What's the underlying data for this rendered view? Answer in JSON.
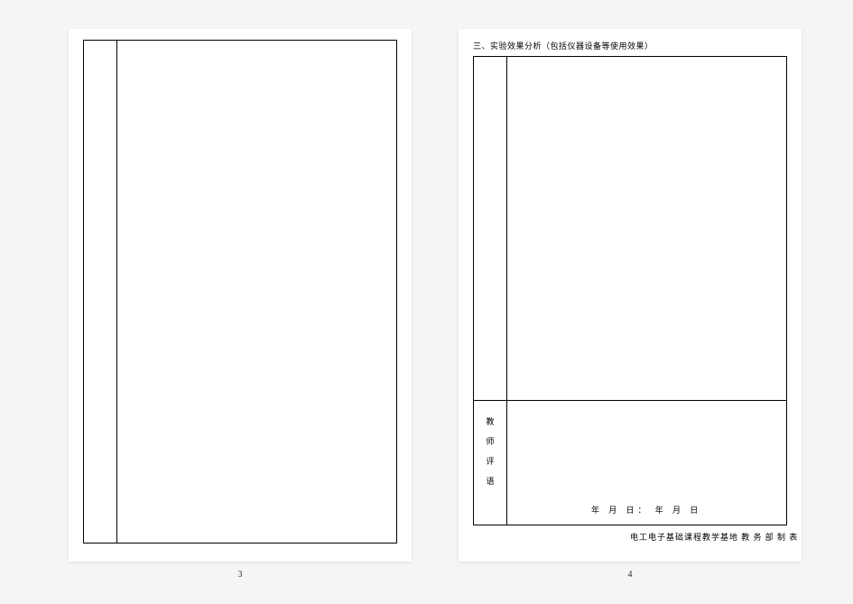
{
  "left_page": {
    "number": "3"
  },
  "right_page": {
    "number": "4",
    "section_title": "三、实验效果分析（包括仪器设备等使用效果）",
    "teacher_label": {
      "c1": "教",
      "c2": "师",
      "c3": "评",
      "c4": "语"
    },
    "date_line": "年  月  日：            年   月   日",
    "footer": "电工电子基础课程教学基地   教 务 部   制 表"
  }
}
